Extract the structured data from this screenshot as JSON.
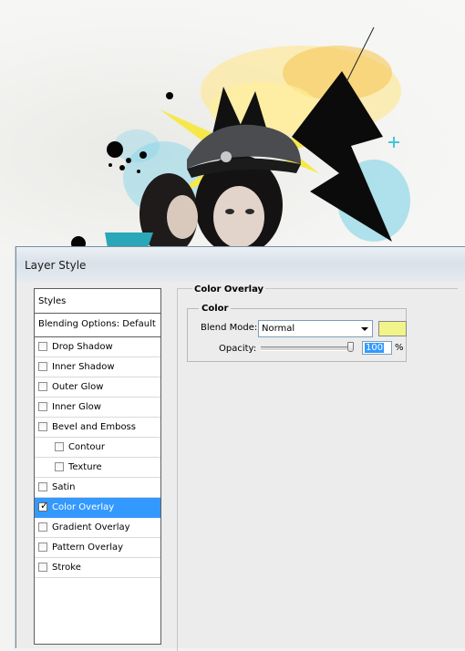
{
  "window": {
    "title": "Layer Style"
  },
  "styles_list": {
    "header": "Styles",
    "blending_options": "Blending Options: Default",
    "items": [
      {
        "label": "Drop Shadow",
        "checked": false,
        "indent": false,
        "selected": false
      },
      {
        "label": "Inner Shadow",
        "checked": false,
        "indent": false,
        "selected": false
      },
      {
        "label": "Outer Glow",
        "checked": false,
        "indent": false,
        "selected": false
      },
      {
        "label": "Inner Glow",
        "checked": false,
        "indent": false,
        "selected": false
      },
      {
        "label": "Bevel and Emboss",
        "checked": false,
        "indent": false,
        "selected": false
      },
      {
        "label": "Contour",
        "checked": false,
        "indent": true,
        "selected": false
      },
      {
        "label": "Texture",
        "checked": false,
        "indent": true,
        "selected": false
      },
      {
        "label": "Satin",
        "checked": false,
        "indent": false,
        "selected": false
      },
      {
        "label": "Color Overlay",
        "checked": true,
        "indent": false,
        "selected": true
      },
      {
        "label": "Gradient Overlay",
        "checked": false,
        "indent": false,
        "selected": false
      },
      {
        "label": "Pattern Overlay",
        "checked": false,
        "indent": false,
        "selected": false
      },
      {
        "label": "Stroke",
        "checked": false,
        "indent": false,
        "selected": false
      }
    ]
  },
  "color_overlay": {
    "group_title": "Color Overlay",
    "sub_title": "Color",
    "blend_mode_label": "Blend Mode:",
    "blend_mode_value": "Normal",
    "overlay_color": "#f0f48a",
    "opacity_label": "Opacity:",
    "opacity_value": "100",
    "opacity_unit": "%",
    "opacity_level": 1.0
  },
  "colors": {
    "selection": "#3399ff",
    "dialog_bg": "#ececec"
  }
}
